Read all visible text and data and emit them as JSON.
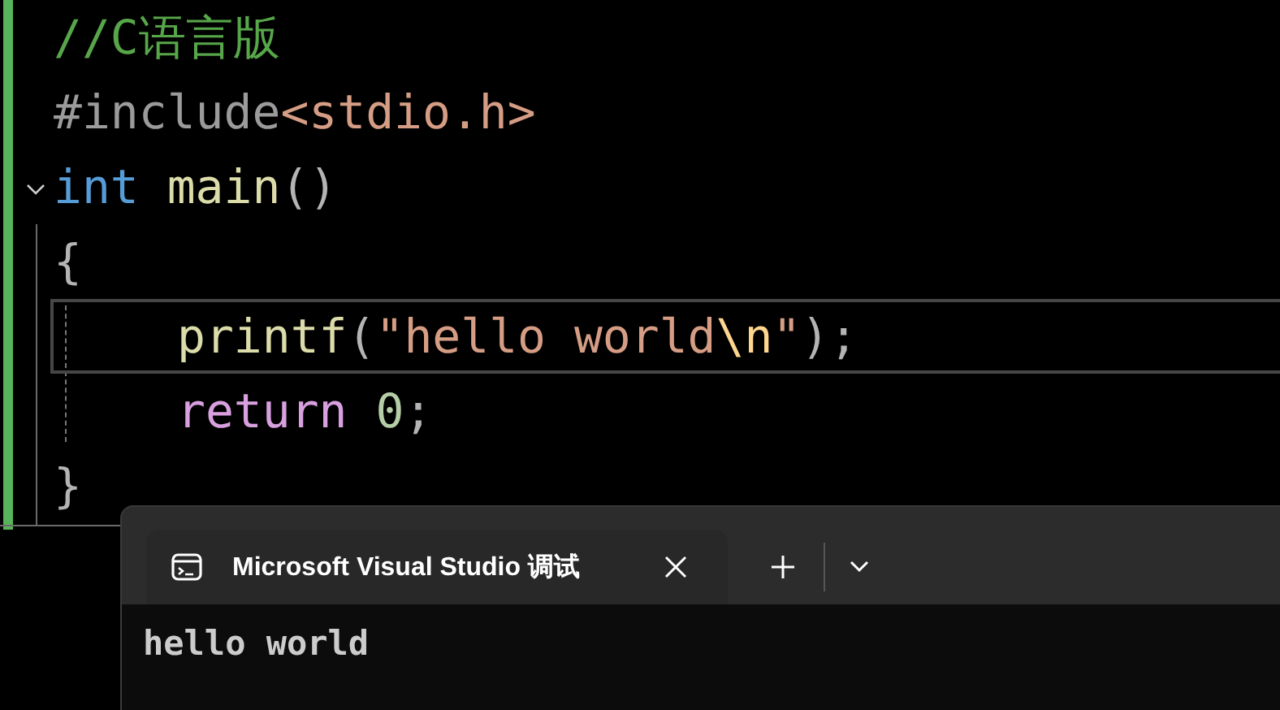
{
  "editor": {
    "lines": [
      {
        "tokens": [
          {
            "kind": "comment",
            "text": "//C语言版"
          }
        ]
      },
      {
        "tokens": [
          {
            "kind": "preprocessor",
            "text": "#include"
          },
          {
            "kind": "header",
            "text": "<stdio.h>"
          }
        ]
      },
      {
        "tokens": [
          {
            "kind": "keyword",
            "text": "int"
          },
          {
            "kind": "function",
            "text": " main"
          },
          {
            "kind": "punct",
            "text": "()"
          }
        ],
        "expanded": true,
        "block": {
          "open": {
            "tokens": [
              {
                "kind": "punct",
                "text": "{"
              }
            ]
          },
          "lines": [
            {
              "tokens": [
                {
                  "kind": "function",
                  "text": "printf"
                },
                {
                  "kind": "punct",
                  "text": "("
                },
                {
                  "kind": "string",
                  "text": "\"hello world"
                },
                {
                  "kind": "escape",
                  "text": "\\n"
                },
                {
                  "kind": "string",
                  "text": "\""
                },
                {
                  "kind": "punct",
                  "text": ");"
                }
              ],
              "selected": true
            },
            {
              "tokens": [
                {
                  "kind": "control",
                  "text": "return"
                },
                {
                  "kind": "number",
                  "text": " 0"
                },
                {
                  "kind": "punct",
                  "text": ";"
                }
              ],
              "selected": false
            }
          ],
          "close": {
            "tokens": [
              {
                "kind": "punct",
                "text": "}"
              }
            ]
          }
        }
      }
    ]
  },
  "console": {
    "tab": {
      "title": "Microsoft Visual Studio 调试"
    },
    "output": "hello world"
  }
}
